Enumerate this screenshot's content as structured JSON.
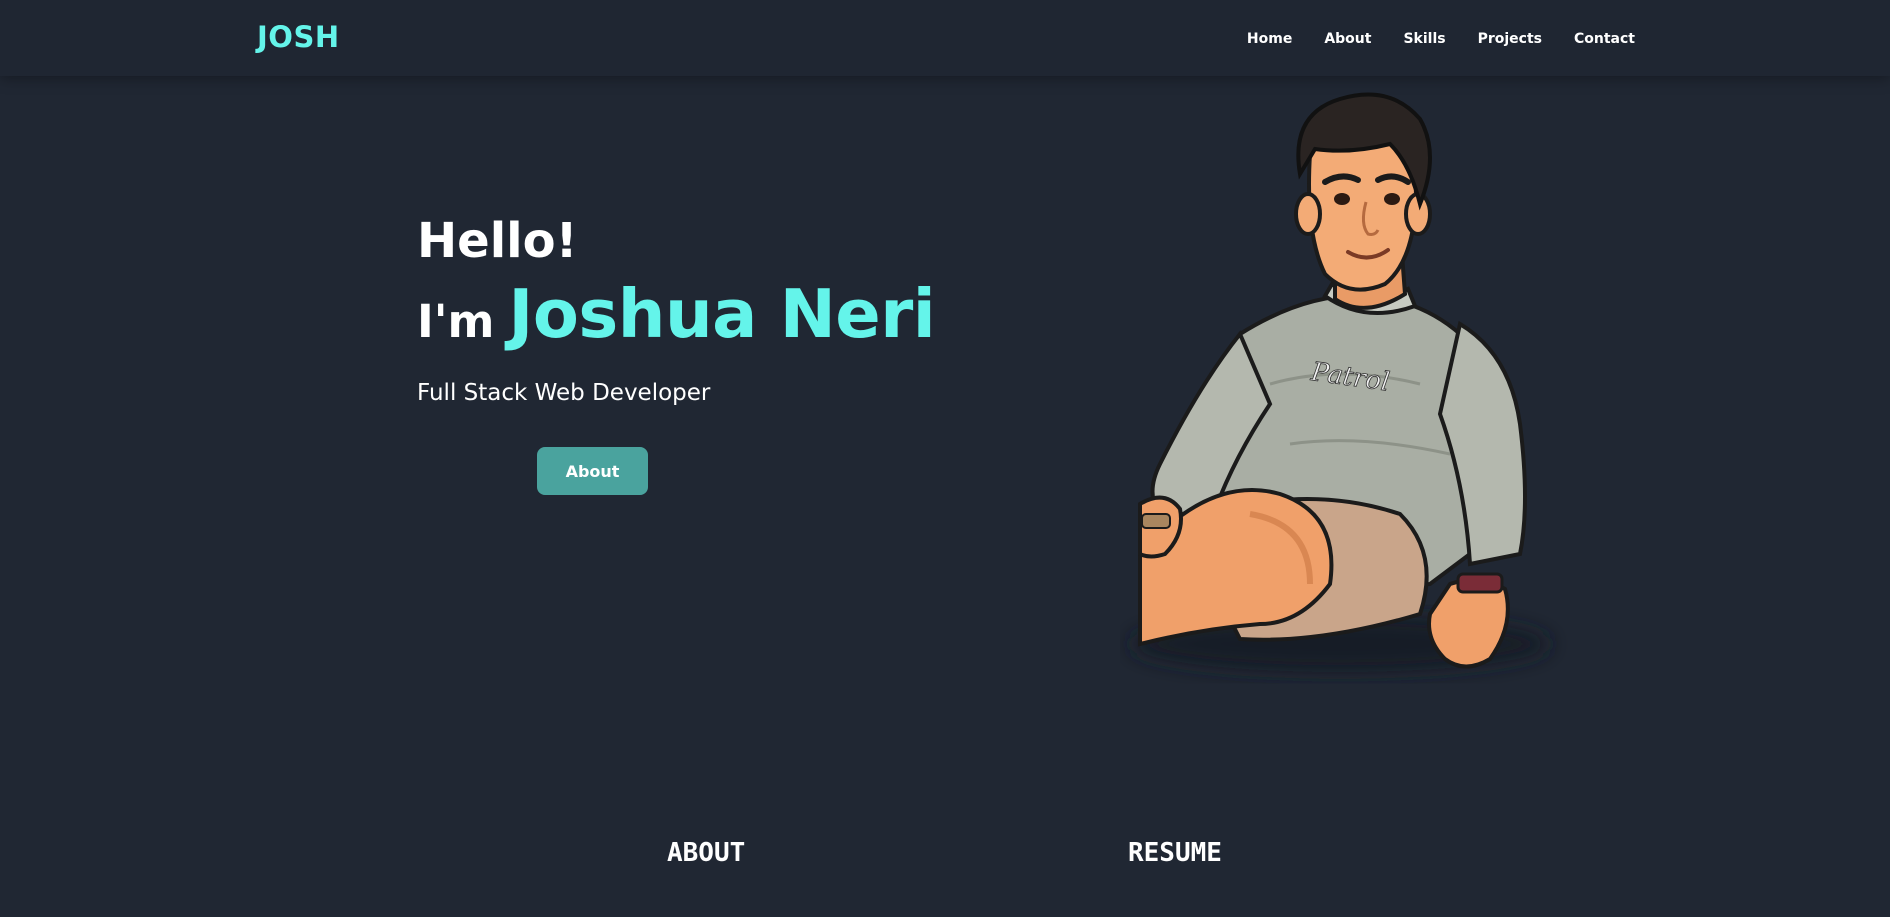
{
  "nav": {
    "brand": "JOSH",
    "links": [
      {
        "label": "Home"
      },
      {
        "label": "About"
      },
      {
        "label": "Skills"
      },
      {
        "label": "Projects"
      },
      {
        "label": "Contact"
      }
    ]
  },
  "hero": {
    "greeting": "Hello!",
    "intro_prefix": "I'm",
    "name": "Joshua Neri",
    "role": "Full Stack Web Developer",
    "button_label": "About"
  },
  "sections": {
    "about": "ABOUT",
    "resume": "RESUME"
  },
  "colors": {
    "background": "#202733",
    "navbar": "#1f2632",
    "accent": "#64f4ea",
    "button": "#4aa39e",
    "text": "#ffffff"
  }
}
